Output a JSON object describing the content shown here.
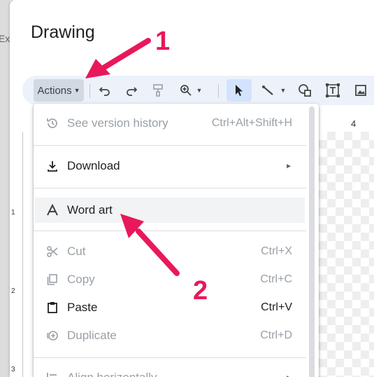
{
  "background": {
    "app_fragment": "Ex"
  },
  "dialog": {
    "title": "Drawing"
  },
  "toolbar": {
    "actions_label": "Actions",
    "icons": [
      "undo-icon",
      "redo-icon",
      "paint-format-icon",
      "zoom-icon",
      "select-icon",
      "line-icon",
      "shape-icon",
      "text-box-icon",
      "image-icon"
    ]
  },
  "ruler": {
    "h_number": "4",
    "v_numbers": [
      "1",
      "2",
      "3"
    ]
  },
  "menu": {
    "items": [
      {
        "label": "See version history",
        "shortcut": "Ctrl+Alt+Shift+H",
        "disabled": true,
        "icon": "history-icon"
      },
      {
        "label": "Download",
        "submenu": true,
        "disabled": false,
        "icon": "download-icon"
      },
      {
        "label": "Word art",
        "disabled": false,
        "highlighted": true,
        "icon": "word-art-icon"
      },
      {
        "label": "Cut",
        "shortcut": "Ctrl+X",
        "disabled": true,
        "icon": "cut-icon"
      },
      {
        "label": "Copy",
        "shortcut": "Ctrl+C",
        "disabled": true,
        "icon": "copy-icon"
      },
      {
        "label": "Paste",
        "shortcut": "Ctrl+V",
        "disabled": false,
        "icon": "paste-icon"
      },
      {
        "label": "Duplicate",
        "shortcut": "Ctrl+D",
        "disabled": true,
        "icon": "duplicate-icon"
      },
      {
        "label": "Align horizontally",
        "submenu": true,
        "disabled": true,
        "icon": "align-icon"
      }
    ]
  },
  "annotations": {
    "step1": "1",
    "step2": "2",
    "color": "#e8195a"
  }
}
